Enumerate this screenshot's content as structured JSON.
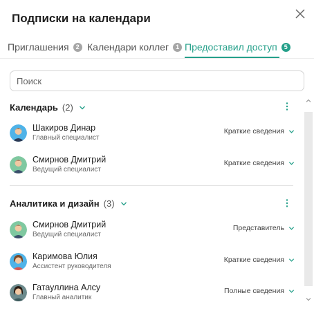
{
  "dialog": {
    "title": "Подписки на календари"
  },
  "tabs": [
    {
      "label": "Приглашения",
      "badge": "2"
    },
    {
      "label": "Календари коллег",
      "badge": "1"
    },
    {
      "label": "Предоставил доступ",
      "badge": "5",
      "active": true
    }
  ],
  "search": {
    "placeholder": "Поиск",
    "value": ""
  },
  "sections": [
    {
      "name": "Календарь",
      "count": "(2)",
      "people": [
        {
          "name": "Шакиров Динар",
          "role": "Главный специалист",
          "access": "Краткие сведения"
        },
        {
          "name": "Смирнов Дмитрий",
          "role": "Ведущий специалист",
          "access": "Краткие сведения"
        }
      ]
    },
    {
      "name": "Аналитика и дизайн",
      "count": "(3)",
      "people": [
        {
          "name": "Смирнов Дмитрий",
          "role": "Ведущий специалист",
          "access": "Представитель"
        },
        {
          "name": "Каримова Юлия",
          "role": "Ассистент руководителя",
          "access": "Краткие сведения"
        },
        {
          "name": "Гатауллина Алсу",
          "role": "Главный аналитик",
          "access": "Полные сведения"
        }
      ]
    }
  ],
  "colors": {
    "accent": "#25a08a",
    "badge_inactive": "#a6a6a6",
    "text": "#1f1f1f",
    "muted": "#666666"
  },
  "icons": {
    "close": "close-icon",
    "chevron": "chevron-down-icon",
    "more": "kebab-menu-icon"
  }
}
